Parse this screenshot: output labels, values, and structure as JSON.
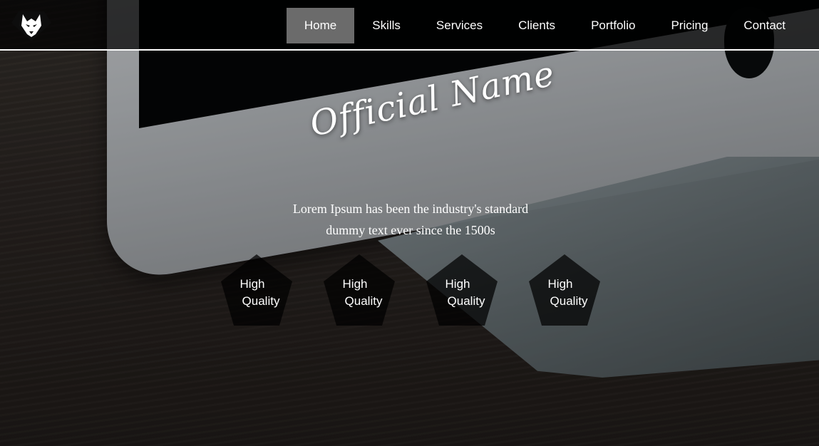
{
  "nav": {
    "items": [
      {
        "label": "Home",
        "active": true
      },
      {
        "label": "Skills",
        "active": false
      },
      {
        "label": "Services",
        "active": false
      },
      {
        "label": "Clients",
        "active": false
      },
      {
        "label": "Portfolio",
        "active": false
      },
      {
        "label": "Pricing",
        "active": false
      },
      {
        "label": "Contact",
        "active": false
      }
    ]
  },
  "hero": {
    "title": "Official Name",
    "subtitle_line1": "Lorem Ipsum has been the industry's standard",
    "subtitle_line2": "dummy text ever since the 1500s"
  },
  "features": [
    {
      "line1": "High",
      "line2": "Quality"
    },
    {
      "line1": "High",
      "line2": "Quality"
    },
    {
      "line1": "High",
      "line2": "Quality"
    },
    {
      "line1": "High",
      "line2": "Quality"
    }
  ],
  "colors": {
    "nav_active_bg": "#6b6b6b",
    "text": "#ffffff"
  },
  "icons": {
    "logo": "wolf-head-logo-icon"
  }
}
